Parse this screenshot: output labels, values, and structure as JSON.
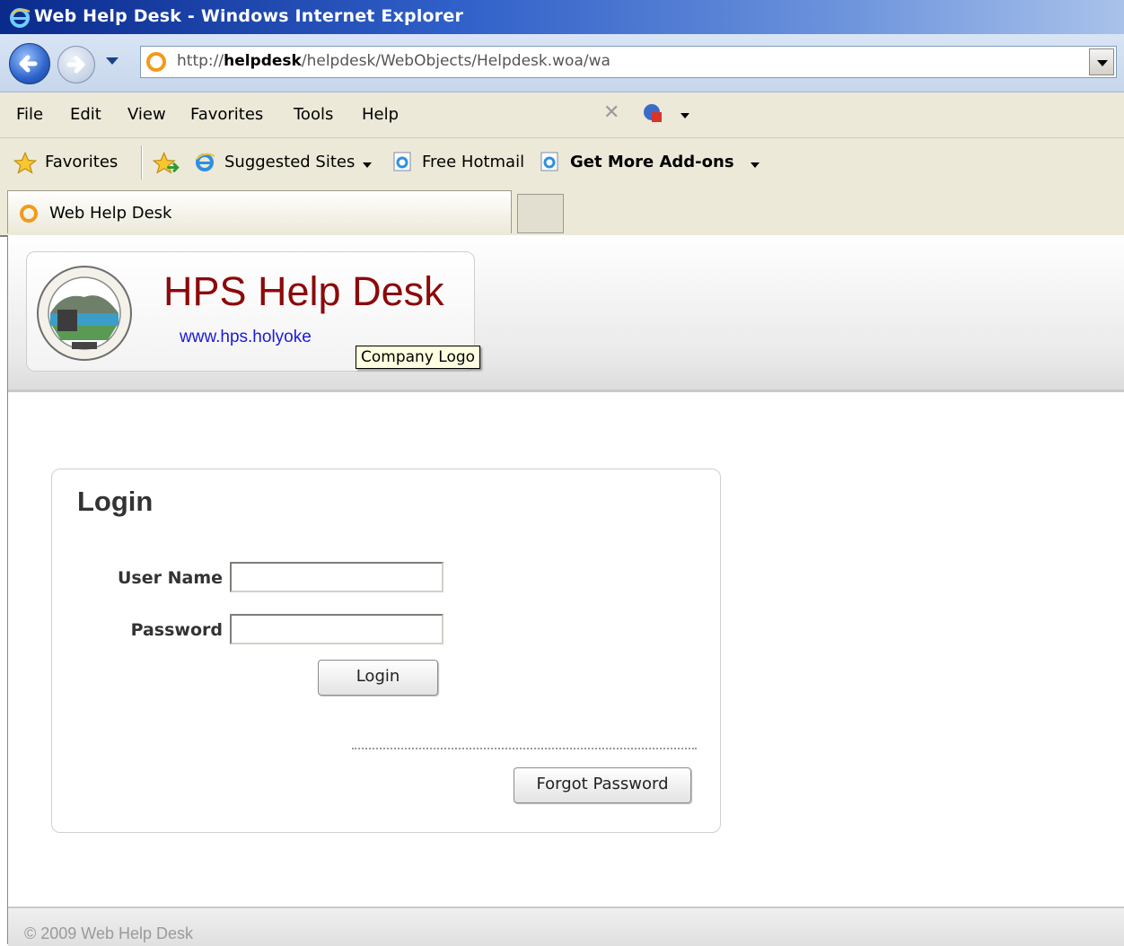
{
  "window": {
    "title": "Web Help Desk - Windows Internet Explorer"
  },
  "address_bar": {
    "url_prefix": "http://",
    "url_host": "helpdesk",
    "url_path": "/helpdesk/WebObjects/Helpdesk.woa/wa"
  },
  "menu": {
    "items": [
      "File",
      "Edit",
      "View",
      "Favorites",
      "Tools",
      "Help"
    ]
  },
  "favorites_bar": {
    "favorites_label": "Favorites",
    "suggested_sites": "Suggested Sites",
    "free_hotmail": "Free Hotmail",
    "get_addons": "Get More Add-ons"
  },
  "tabs": {
    "active_label": "Web Help Desk"
  },
  "header": {
    "site_title": "HPS Help Desk",
    "site_url": "www.hps.holyoke",
    "tooltip": "Company Logo"
  },
  "login": {
    "title": "Login",
    "username_label": "User Name",
    "password_label": "Password",
    "username_value": "",
    "password_value": "",
    "login_button": "Login",
    "forgot_button": "Forgot Password"
  },
  "footer": {
    "copyright": "© 2009 Web Help Desk"
  },
  "colors": {
    "title_red": "#8b0a0a",
    "link_blue": "#1a1adc",
    "titlebar": "#0a2a8c"
  }
}
